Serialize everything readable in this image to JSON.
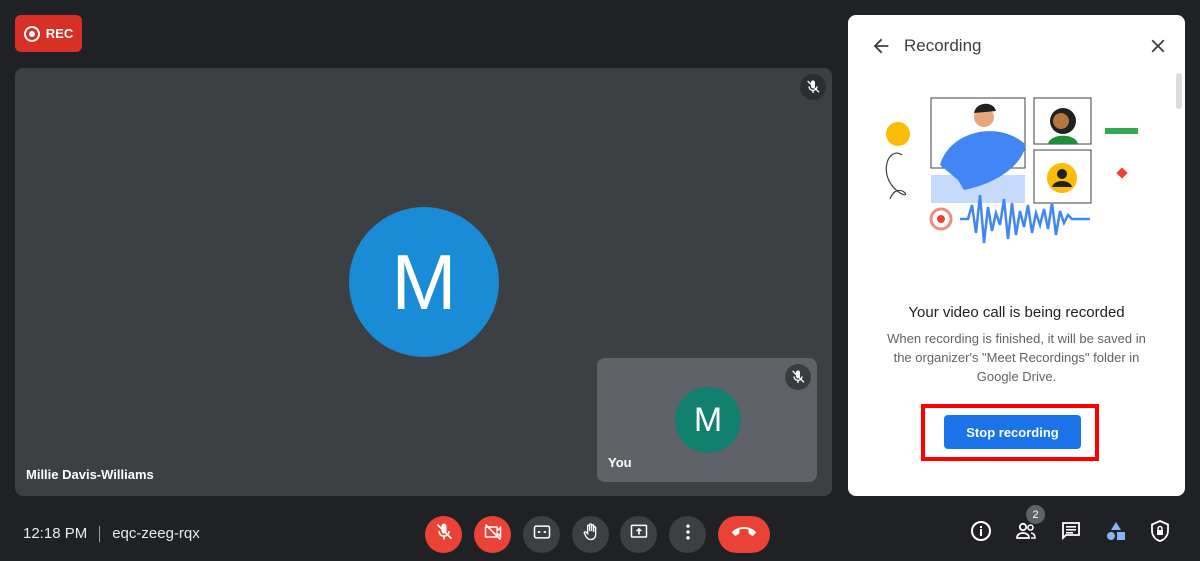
{
  "rec_badge": {
    "label": "REC",
    "color": "#d93025"
  },
  "main_tile": {
    "avatar_letter": "M",
    "avatar_color": "#1a8bd6",
    "participant_name": "Millie Davis-Williams"
  },
  "self_tile": {
    "avatar_letter": "M",
    "avatar_color": "#12806f",
    "label": "You"
  },
  "panel": {
    "title": "Recording",
    "heading": "Your video call is being recorded",
    "body": "When recording is finished, it will be saved in the organizer's \"Meet Recordings\" folder in Google Drive.",
    "stop_label": "Stop recording",
    "accent_color": "#1a73e8"
  },
  "bottom_bar": {
    "time": "12:18 PM",
    "meeting_code": "eqc-zeeg-rqx",
    "controls": [
      "mic-off-icon",
      "camera-off-icon",
      "captions-icon",
      "raise-hand-icon",
      "present-icon",
      "more-options-icon",
      "end-call-icon"
    ],
    "right_icons": [
      "info-icon",
      "people-icon",
      "chat-icon",
      "activities-icon",
      "host-controls-icon"
    ],
    "people_count": "2"
  }
}
